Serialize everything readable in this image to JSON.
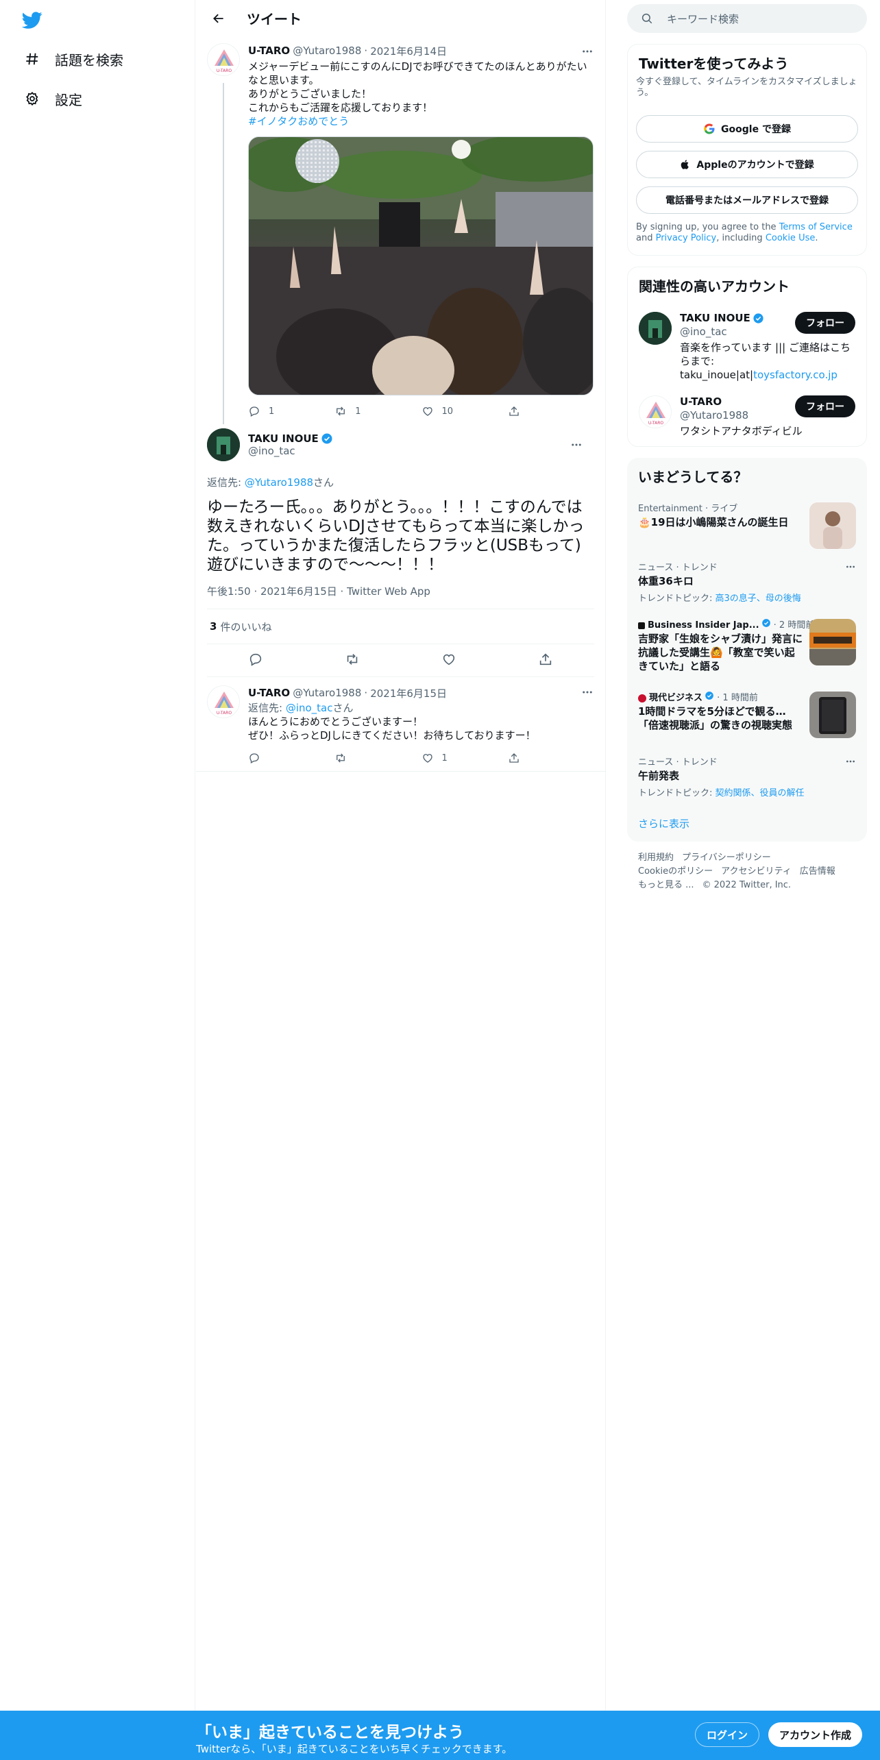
{
  "nav": {
    "explore_label": "話題を検索",
    "settings_label": "設定"
  },
  "header": {
    "title": "ツイート"
  },
  "tweet1": {
    "name": "U-TARO",
    "handle": "@Yutaro1988",
    "date": "2021年6月14日",
    "text": "メジャーデビュー前にこすのんにDJでお呼びできてたのほんとありがたいなと思います。\nありがとうございました！\nこれからもご活躍を応援しております！",
    "hashtag": "#イノタクおめでとう",
    "replies": "1",
    "retweets": "1",
    "likes": "10"
  },
  "focal": {
    "name": "TAKU INOUE",
    "handle": "@ino_tac",
    "reply_prefix": "返信先: ",
    "reply_to": "@Yutaro1988",
    "reply_suffix": "さん",
    "text": "ゆーたろー氏。。。ありがとう。。。！！！こすのんでは数えきれないくらいDJさせてもらって本当に楽しかった。っていうかまた復活したらフラッと(USBもって)遊びにいきますので〜〜〜！！！",
    "meta": "午後1:50 · 2021年6月15日 · Twitter Web App",
    "likes_count": "3",
    "likes_label": "件のいいね"
  },
  "tweet3": {
    "name": "U-TARO",
    "handle": "@Yutaro1988",
    "date": "2021年6月15日",
    "reply_prefix": "返信先: ",
    "reply_to": "@ino_tac",
    "reply_suffix": "さん",
    "text": "ほんとうにおめでとうございますー！\nぜひ！ふらっとDJしにきてください！お待ちしておりますー！",
    "likes": "1"
  },
  "right": {
    "search_placeholder": "キーワード検索",
    "signup": {
      "title": "Twitterを使ってみよう",
      "sub": "今すぐ登録して、タイムラインをカスタマイズしましょう。",
      "google": "Google で登録",
      "apple": "Appleのアカウントで登録",
      "phone": "電話番号またはメールアドレスで登録",
      "terms_pre": "By signing up, you agree to the ",
      "terms_tos": "Terms of Service",
      "terms_and": " and ",
      "terms_pp": "Privacy Policy",
      "terms_incl": ", including ",
      "terms_cookie": "Cookie Use",
      "terms_end": "."
    },
    "related": {
      "title": "関連性の高いアカウント",
      "accounts": [
        {
          "name": "TAKU INOUE",
          "handle": "@ino_tac",
          "bio": "音楽を作っています ||| ご連絡はこちらまで: taku_inoue|at|",
          "bio_link": "toysfactory.co.jp",
          "follow": "フォロー"
        },
        {
          "name": "U-TARO",
          "handle": "@Yutaro1988",
          "bio": "ワタシトアナタボディビル",
          "follow": "フォロー"
        }
      ]
    },
    "trends": {
      "title": "いまどうしてる？",
      "items": [
        {
          "context": "Entertainment · ライブ",
          "title": "🎂19日は小嶋陽菜さんの誕生日"
        },
        {
          "context": "ニュース · トレンド",
          "title": "体重36キロ",
          "topic_label": "トレンドトピック: ",
          "topic": "高3の息子、母の後悔"
        },
        {
          "source": "Business Insider Jap...",
          "time": " · 2 時間前",
          "title": "吉野家「生娘をシャブ漬け」発言に抗議した受講生🙆「教室で笑い起きていた」と語る"
        },
        {
          "source": "現代ビジネス",
          "time": " · 1 時間前",
          "title": "1時間ドラマを5分ほどで観る…「倍速視聴派」の驚きの視聴実態"
        },
        {
          "context": "ニュース · トレンド",
          "title": "午前発表",
          "topic_label": "トレンドトピック: ",
          "topic": "契約関係、役員の解任"
        }
      ],
      "show_more": "さらに表示"
    },
    "footer": {
      "terms": "利用規約",
      "privacy": "プライバシーポリシー",
      "cookie": "Cookieのポリシー",
      "access": "アクセシビリティ",
      "ads": "広告情報",
      "more": "もっと見る ...",
      "copyright": "© 2022 Twitter, Inc."
    }
  },
  "bottom": {
    "title": "「いま」起きていることを見つけよう",
    "sub": "Twitterなら、「いま」起きていることをいち早くチェックできます。",
    "login": "ログイン",
    "register": "アカウント作成"
  },
  "colors": {
    "accent": "#1d9bf0",
    "text": "#0f1419",
    "muted": "#536471"
  },
  "icons": [
    "twitter-logo-icon",
    "hashtag-icon",
    "gear-icon",
    "back-arrow-icon",
    "more-icon",
    "reply-icon",
    "retweet-icon",
    "like-icon",
    "share-icon",
    "search-icon",
    "verified-icon",
    "google-icon",
    "apple-icon"
  ]
}
